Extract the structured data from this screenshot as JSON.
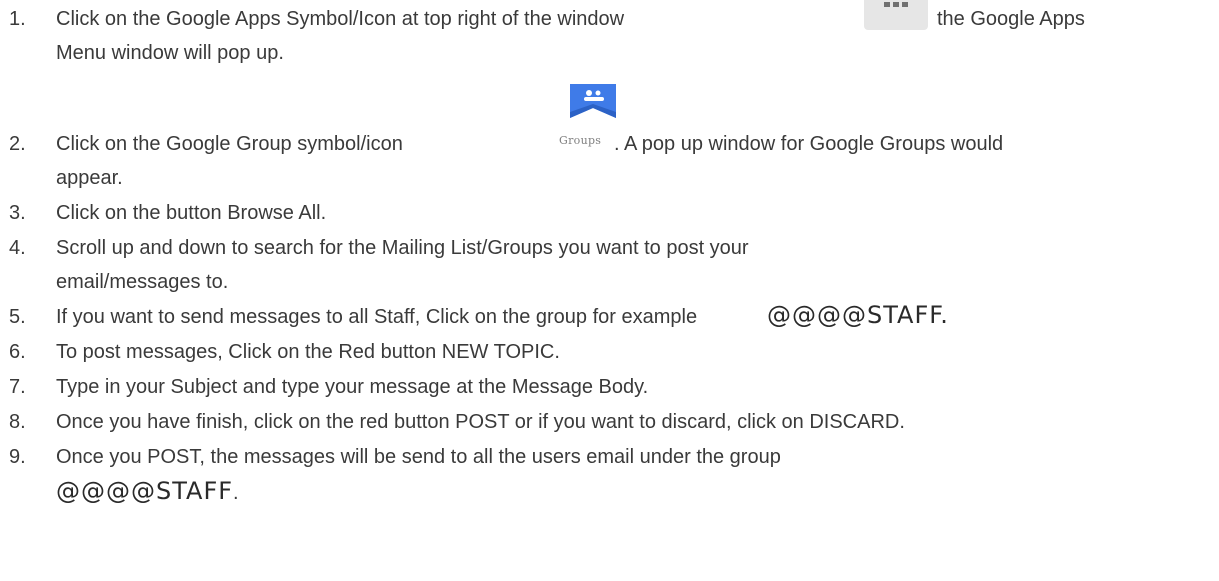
{
  "instructions": [
    {
      "number": "1.",
      "lines": [
        "Click on the Google Apps Symbol/Icon at top right of the window",
        "Menu window will pop up."
      ],
      "suffix": "the Google Apps"
    },
    {
      "number": "2.",
      "lines": [
        "Click on the Google Group symbol/icon",
        "appear."
      ],
      "suffix": ". A pop up window for Google Groups would"
    },
    {
      "number": "3.",
      "lines": [
        "Click on the button Browse All."
      ]
    },
    {
      "number": "4.",
      "lines": [
        "Scroll up and down to search for the Mailing List/Groups you want to post your",
        "email/messages to."
      ]
    },
    {
      "number": "5.",
      "lines": [
        "If you want to send messages to all Staff, Click on the group for example"
      ],
      "highlight": "@@@@STAFF."
    },
    {
      "number": "6.",
      "lines": [
        "To post messages, Click on the Red button NEW TOPIC."
      ]
    },
    {
      "number": "7.",
      "lines": [
        "Type in your Subject and type your message at the Message Body."
      ]
    },
    {
      "number": "8.",
      "lines": [
        "Once you have finish, click on the red button POST or if you want to discard, click on DISCARD."
      ]
    },
    {
      "number": "9.",
      "lines": [
        "Once you POST, the messages will be send to all the users email under the group"
      ],
      "highlight_line": "@@@@STAFF",
      "trailing": "."
    }
  ],
  "icons": {
    "apps": "apps-grid-icon",
    "groups": "google-groups-icon",
    "groups_label": "Groups"
  },
  "colors": {
    "text": "#3a3a3a",
    "groups_blue": "#3f7be8",
    "apps_bg": "#e6e6e6"
  }
}
